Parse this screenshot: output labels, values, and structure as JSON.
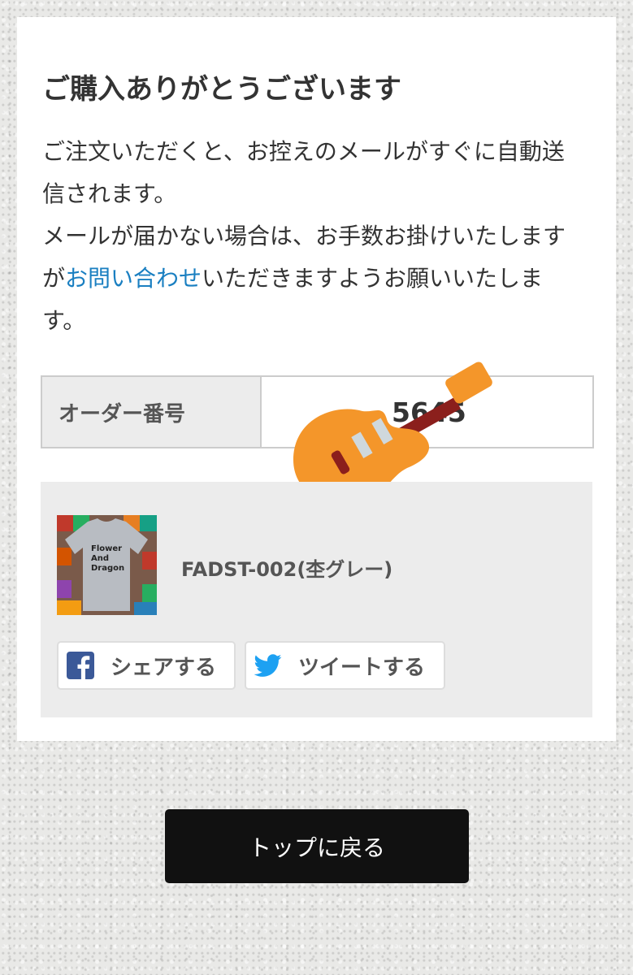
{
  "card": {
    "title": "ご購入ありがとうございます",
    "message": {
      "line1": "ご注文いただくと、お控えのメールがすぐに自動送",
      "line2": "信されます。",
      "line3": "メールが届かない場合は、お手数お掛けいたします",
      "line4_prefix": "が",
      "contact_link": "お問い合わせ",
      "line4_suffix": "いただきますようお願いいたしま",
      "line5": "す。"
    },
    "order": {
      "label": "オーダー番号",
      "value": "5645"
    },
    "product": {
      "name": "FADST-002(杢グレー)",
      "thumbnail_text": [
        "Flower",
        "And",
        "Dragon"
      ]
    },
    "share": {
      "facebook_label": "シェアする",
      "twitter_label": "ツイートする"
    }
  },
  "back_to_top_label": "トップに戻る",
  "colors": {
    "link": "#1a7fc1",
    "facebook": "#3b5998",
    "twitter": "#1da1f2",
    "guitar": "#f4962a",
    "button": "#111111"
  },
  "icons": [
    "guitar-emoji",
    "facebook-icon",
    "twitter-icon"
  ]
}
